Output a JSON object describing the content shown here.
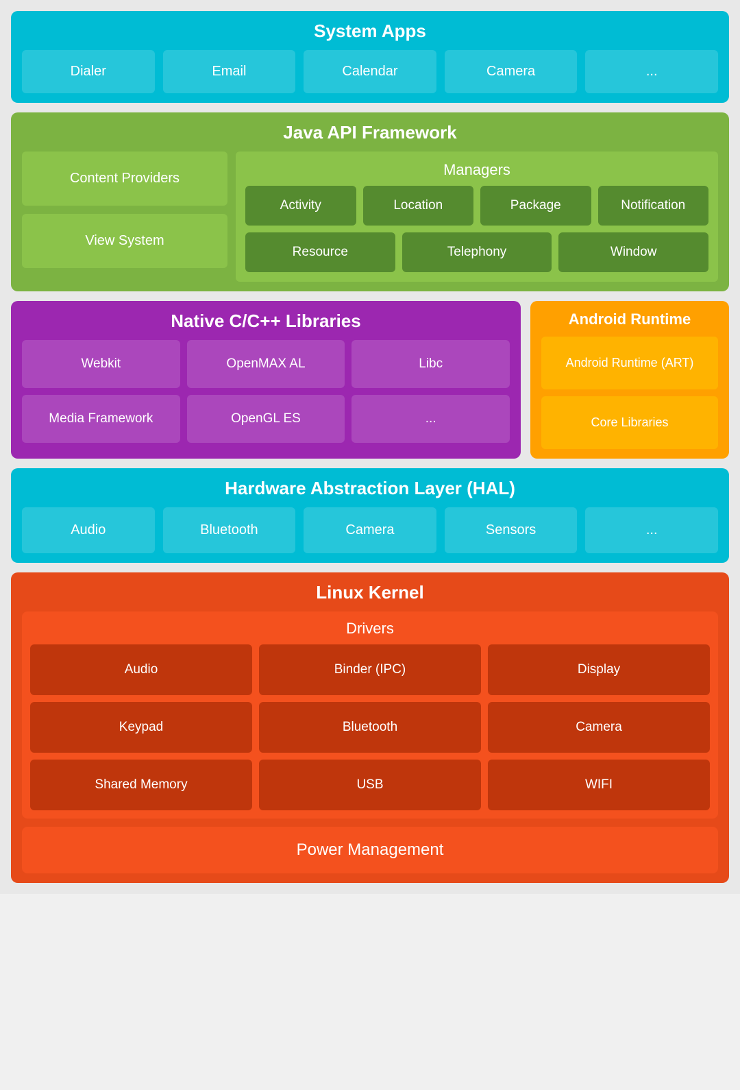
{
  "systemApps": {
    "title": "System Apps",
    "apps": [
      "Dialer",
      "Email",
      "Calendar",
      "Camera",
      "..."
    ]
  },
  "javaApi": {
    "title": "Java API Framework",
    "leftItems": [
      "Content Providers",
      "View System"
    ],
    "managers": {
      "title": "Managers",
      "row1": [
        "Activity",
        "Location",
        "Package",
        "Notification"
      ],
      "row2": [
        "Resource",
        "Telephony",
        "Window"
      ]
    }
  },
  "nativeLibs": {
    "title": "Native C/C++ Libraries",
    "items": [
      "Webkit",
      "OpenMAX AL",
      "Libc",
      "Media Framework",
      "OpenGL ES",
      "..."
    ]
  },
  "androidRuntime": {
    "title": "Android Runtime",
    "items": [
      "Android Runtime (ART)",
      "Core Libraries"
    ]
  },
  "hal": {
    "title": "Hardware Abstraction Layer (HAL)",
    "items": [
      "Audio",
      "Bluetooth",
      "Camera",
      "Sensors",
      "..."
    ]
  },
  "linuxKernel": {
    "title": "Linux Kernel",
    "drivers": {
      "title": "Drivers",
      "items": [
        "Audio",
        "Binder (IPC)",
        "Display",
        "Keypad",
        "Bluetooth",
        "Camera",
        "Shared Memory",
        "USB",
        "WIFI"
      ]
    },
    "powerManagement": "Power Management"
  }
}
